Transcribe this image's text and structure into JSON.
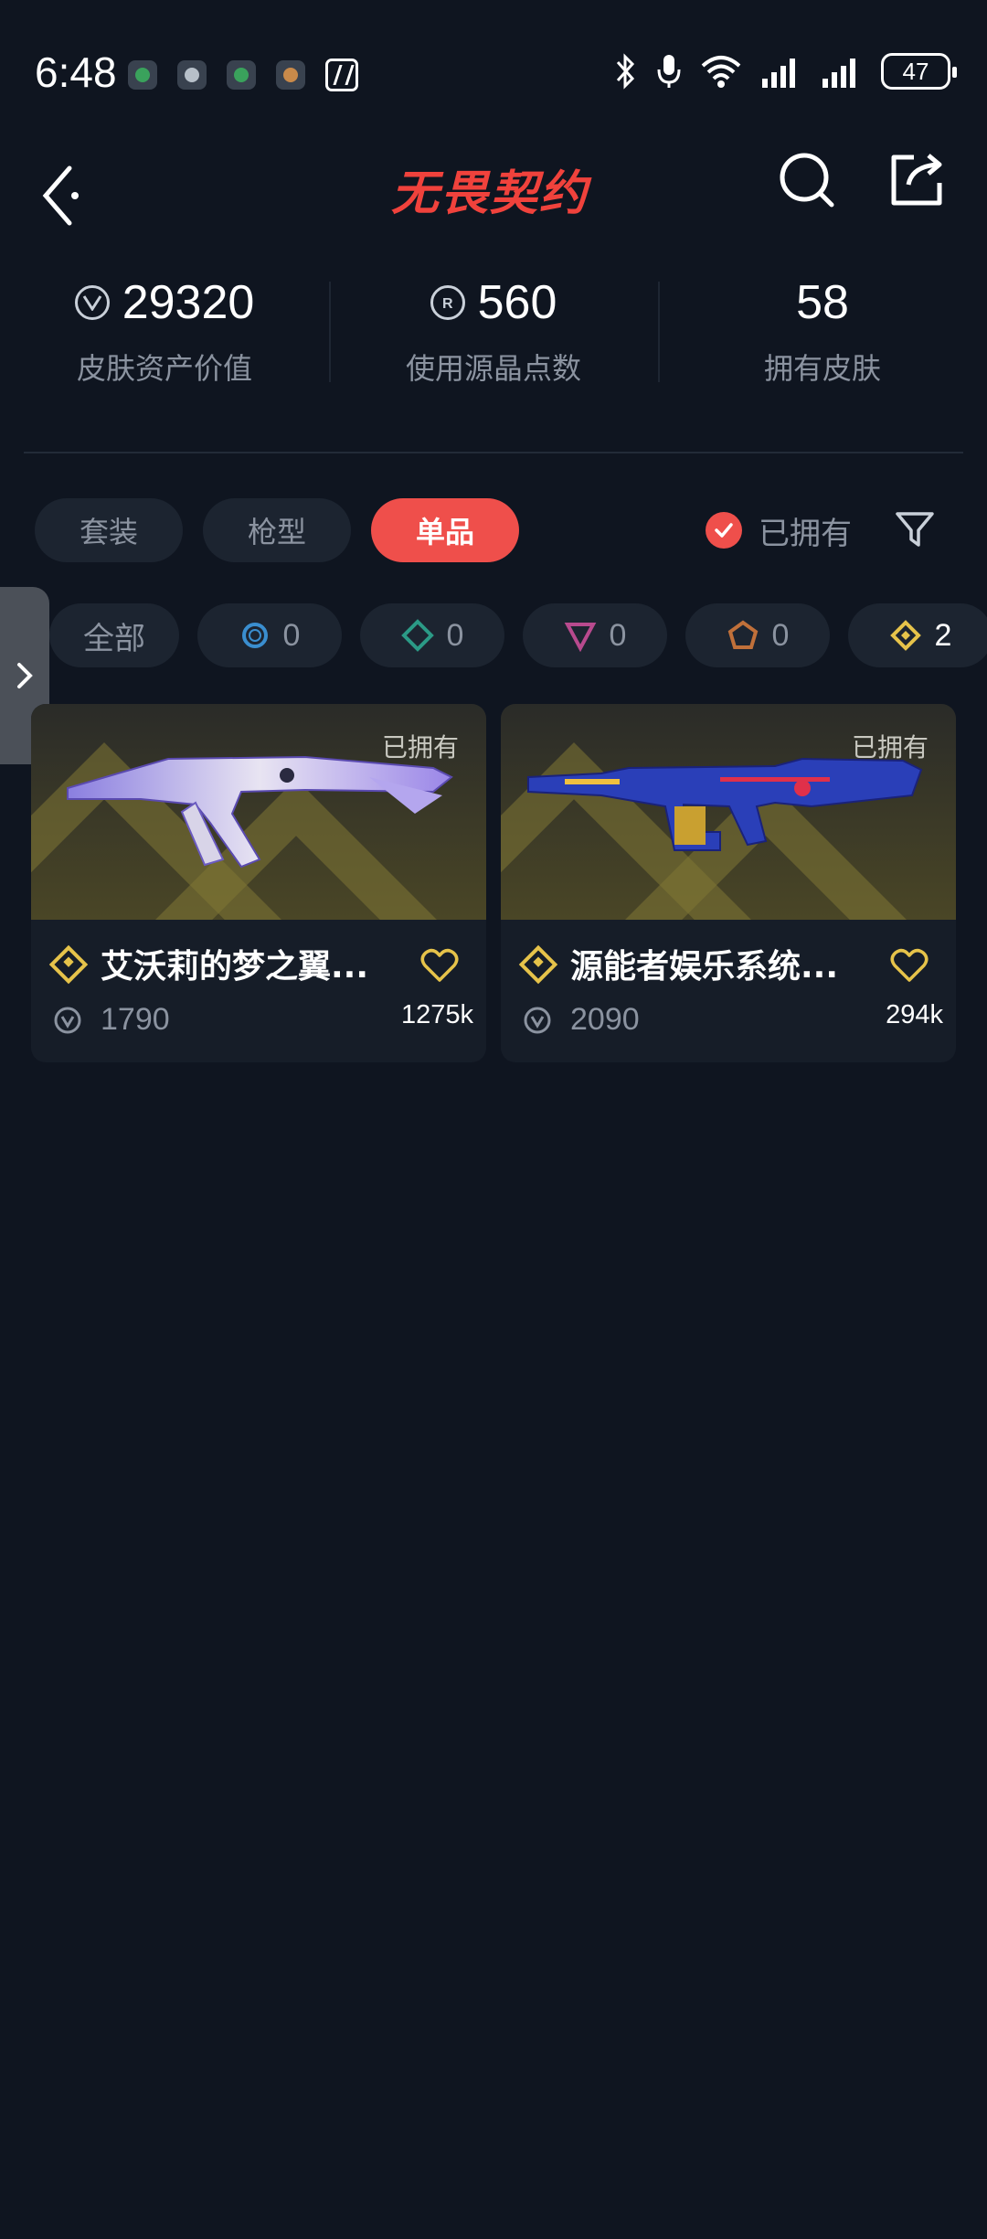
{
  "status_bar": {
    "time": "6:48",
    "notification_icons": [
      "app-notification-icon",
      "app-notification-icon",
      "app-notification-icon",
      "app-notification-icon"
    ],
    "battery": "47"
  },
  "nav": {
    "title": "无畏契约"
  },
  "stats": [
    {
      "value": "29320",
      "label": "皮肤资产价值",
      "icon": "vp-coin-icon"
    },
    {
      "value": "560",
      "label": "使用源晶点数",
      "icon": "radianite-coin-icon"
    },
    {
      "value": "58",
      "label": "拥有皮肤",
      "icon": ""
    }
  ],
  "tabs": [
    {
      "label": "套装",
      "active": false
    },
    {
      "label": "枪型",
      "active": false
    },
    {
      "label": "单品",
      "active": true
    }
  ],
  "owned_filter": {
    "label": "已拥有",
    "checked": true
  },
  "rarity_filters": [
    {
      "label": "全部",
      "count": ""
    },
    {
      "label": "",
      "count": "0",
      "color": "#3a8ecf"
    },
    {
      "label": "",
      "count": "0",
      "color": "#2b9a86"
    },
    {
      "label": "",
      "count": "0",
      "color": "#b84a8e"
    },
    {
      "label": "",
      "count": "0",
      "color": "#c0703a"
    },
    {
      "label": "",
      "count": "2",
      "color": "#e6c34a"
    }
  ],
  "skins": [
    {
      "name": "艾沃莉的梦之翼...",
      "owned_tag": "已拥有",
      "price": "1790",
      "views": "1275k"
    },
    {
      "name": "源能者娱乐系统...",
      "owned_tag": "已拥有",
      "price": "2090",
      "views": "294k"
    }
  ],
  "colors": {
    "background": "#0f1520",
    "accent": "#ef4f4b",
    "rarity_exclusive": "#e6c34a"
  }
}
